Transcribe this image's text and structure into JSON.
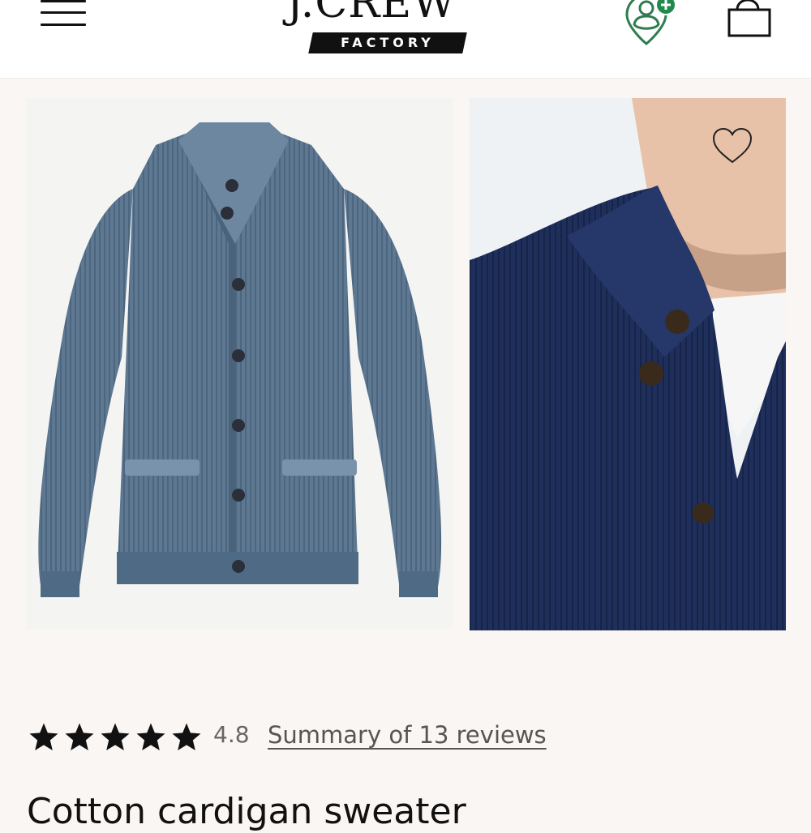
{
  "header": {
    "logo_wordmark": "J.CREW",
    "logo_subtitle": "FACTORY",
    "icons": {
      "menu": "hamburger-menu-icon",
      "account": "account-location-pin-icon",
      "bag": "shopping-bag-icon"
    },
    "account_badge_color": "#1f8a4c",
    "icon_color": "#2e7d4f"
  },
  "gallery": {
    "images": [
      {
        "description_name": "blue heather ribbed cardigan flat product image"
      },
      {
        "description_name": "navy cardigan on model close-up"
      }
    ],
    "favorite_icon": "heart-outline-icon"
  },
  "rating": {
    "stars": 5,
    "value": "4.8",
    "reviews_link": "Summary of 13 reviews"
  },
  "product": {
    "title": "Cotton cardigan sweater"
  },
  "colors": {
    "page_bg": "#faf6f3",
    "cardigan_blue": "#5e7892",
    "cardigan_navy": "#1f2f5c",
    "text": "#111111"
  }
}
